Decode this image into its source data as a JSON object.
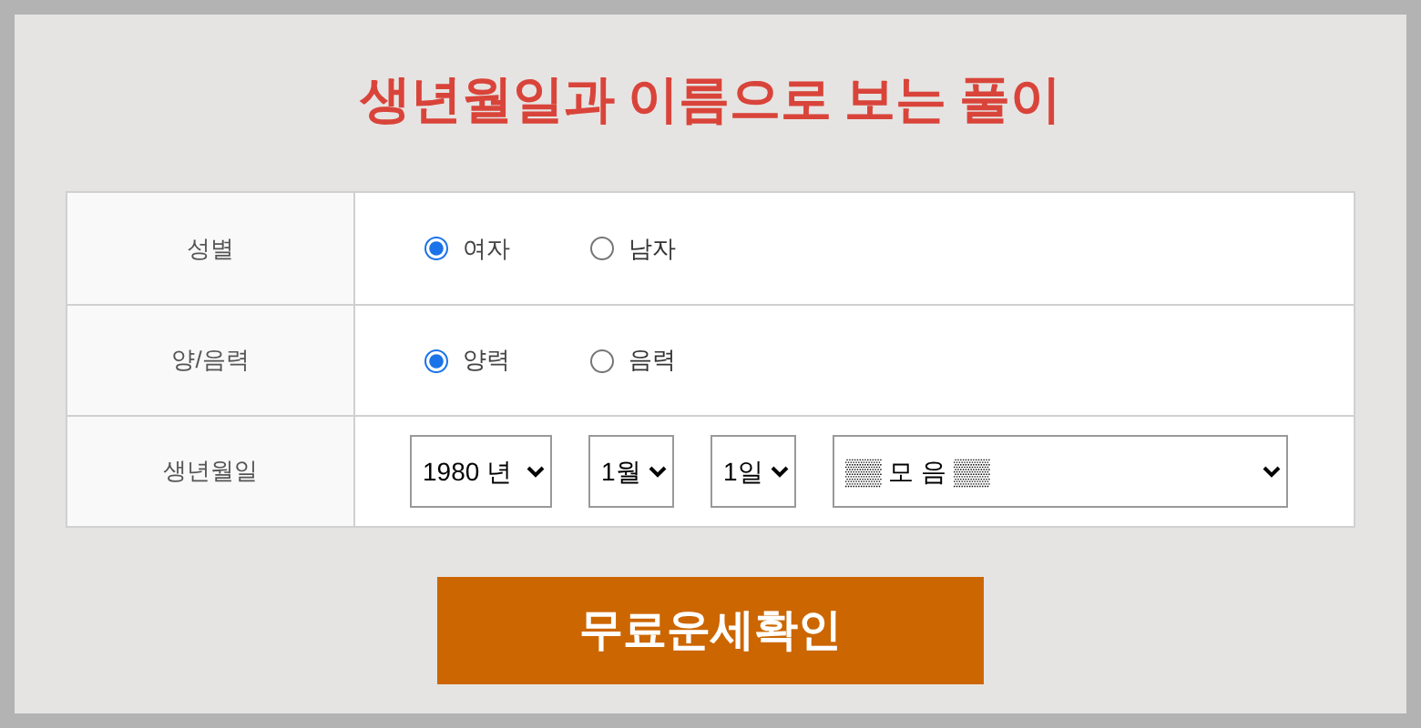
{
  "title": "생년월일과 이름으로 보는 풀이",
  "rows": [
    {
      "label": "성별",
      "kind": "radio",
      "options": [
        {
          "label": "여자",
          "selected": true
        },
        {
          "label": "남자",
          "selected": false
        }
      ]
    },
    {
      "label": "양/음력",
      "kind": "radio",
      "options": [
        {
          "label": "양력",
          "selected": true
        },
        {
          "label": "음력",
          "selected": false
        }
      ]
    },
    {
      "label": "생년월일",
      "kind": "selects",
      "selects": [
        {
          "value": "1980 년"
        },
        {
          "value": "1월"
        },
        {
          "value": "1일"
        },
        {
          "value": "▒▒ 모 음 ▒▒"
        }
      ]
    }
  ],
  "submit": "무료운세확인"
}
